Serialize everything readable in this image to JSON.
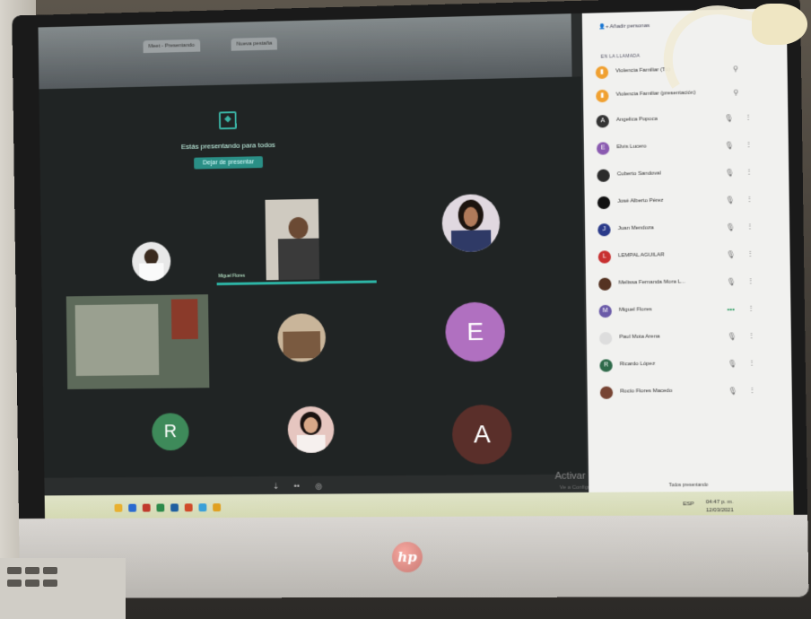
{
  "browser": {
    "tabs": [
      "Meet - Presentando",
      "Nueva pestaña"
    ]
  },
  "meeting": {
    "presenting_text": "Estás presentando para todos",
    "stop_button": "Dejar de presentar",
    "speaker_name": "Miguel Flores",
    "tiles": [
      {
        "letter": "E",
        "color": "#b070c0"
      },
      {
        "letter": "R",
        "color": "#3e8a5a"
      },
      {
        "letter": "A",
        "color": "#5a2f2a"
      }
    ],
    "watermark": "Activar Windows",
    "watermark_sub": "Ve a Configuración para activar Windows."
  },
  "panel": {
    "add_people": "Añadir personas",
    "in_call": "EN LA LLAMADA",
    "participants": [
      {
        "initial": "",
        "name": "Violencia Familiar (Tú)",
        "color": "#f0a030",
        "mic": "",
        "icon": "bars"
      },
      {
        "initial": "",
        "name": "Violencia Familiar (presentación)",
        "color": "#f0a030",
        "mic": "",
        "icon": "bars"
      },
      {
        "initial": "A",
        "name": "Angelica Popoca",
        "color": "#333333",
        "mic": "🎙̸"
      },
      {
        "initial": "E",
        "name": "Elvis Lucero",
        "color": "#8a5ab0",
        "mic": "🎙̸"
      },
      {
        "initial": "",
        "name": "Cuberto Sandoval",
        "color": "#2b2b2b",
        "mic": "🎙̸"
      },
      {
        "initial": "",
        "name": "José Alberto Pérez",
        "color": "#111111",
        "mic": "🎙̸"
      },
      {
        "initial": "J",
        "name": "Juan Mendoza",
        "color": "#2a3a8a",
        "mic": "🎙̸"
      },
      {
        "initial": "L",
        "name": "LEMPAL AGUILAR",
        "color": "#c83030",
        "mic": "🎙̸"
      },
      {
        "initial": "",
        "name": "Melissa Fernanda Mora L...",
        "color": "#553322",
        "mic": "🎙̸"
      },
      {
        "initial": "M",
        "name": "Miguel Flores",
        "color": "#6a5aa8",
        "mic": "•••"
      },
      {
        "initial": "",
        "name": "Paul Mota Arena",
        "color": "#dddddd",
        "mic": "🎙̸"
      },
      {
        "initial": "R",
        "name": "Ricardo López",
        "color": "#2e6a4a",
        "mic": "🎙̸"
      },
      {
        "initial": "",
        "name": "Rocío Flores Macedo",
        "color": "#774433",
        "mic": "🎙̸"
      }
    ]
  },
  "taskbar": {
    "todos_presentando": "Todos presentando",
    "lang": "ESP",
    "time": "04:47 p. m.",
    "date": "12/03/2021"
  },
  "colors": {
    "accent": "#2db5a6",
    "taskbar": "#d7dcb6"
  }
}
